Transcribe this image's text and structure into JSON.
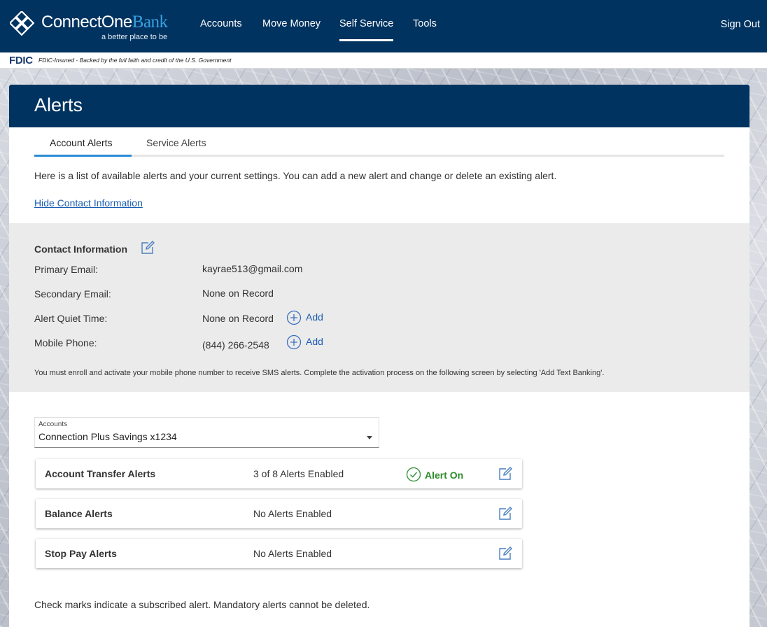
{
  "brand": {
    "name_part1": "ConnectOne",
    "name_part2": "Bank",
    "tagline": "a better place to be"
  },
  "nav": {
    "items": [
      {
        "label": "Accounts"
      },
      {
        "label": "Move Money"
      },
      {
        "label": "Self Service"
      },
      {
        "label": "Tools"
      }
    ],
    "active": "Self Service",
    "sign_out": "Sign Out"
  },
  "fdic": {
    "logo": "FDIC",
    "text": "FDIC-Insured - Backed by the full faith and credit of the U.S. Government"
  },
  "page": {
    "title": "Alerts",
    "tabs": [
      {
        "label": "Account Alerts"
      },
      {
        "label": "Service Alerts"
      }
    ],
    "active_tab": "Account Alerts",
    "intro": "Here is a list of available alerts and your current settings. You can add a new alert and change or delete an existing alert.",
    "hide_contact_link": "Hide Contact Information"
  },
  "contact": {
    "title": "Contact Information",
    "rows": [
      {
        "label": "Primary Email:",
        "value": "kayrae513@gmail.com"
      },
      {
        "label": "Secondary Email:",
        "value": "None on Record"
      },
      {
        "label": "Alert Quiet Time:",
        "value": "None on Record",
        "action": "Add"
      },
      {
        "label": "Mobile Phone:",
        "value": "(844) 266-2548",
        "action": "Add"
      }
    ],
    "note": "You must enroll and activate your mobile phone number to receive SMS alerts. Complete the activation process on the following screen by selecting 'Add Text Banking'."
  },
  "accounts_select": {
    "label": "Accounts",
    "value": "Connection Plus Savings x1234"
  },
  "alert_groups": [
    {
      "name": "Account Transfer Alerts",
      "status": "3 of 8 Alerts Enabled",
      "badge": "Alert On"
    },
    {
      "name": "Balance Alerts",
      "status": "No Alerts Enabled"
    },
    {
      "name": "Stop Pay Alerts",
      "status": "No Alerts Enabled"
    }
  ],
  "footnote": "Check marks indicate a subscribed alert. Mandatory alerts cannot be deleted.",
  "colors": {
    "navy": "#003360",
    "link_blue": "#1a5db0",
    "tab_accent": "#2a8bd6",
    "success_green": "#2e8b2e"
  }
}
